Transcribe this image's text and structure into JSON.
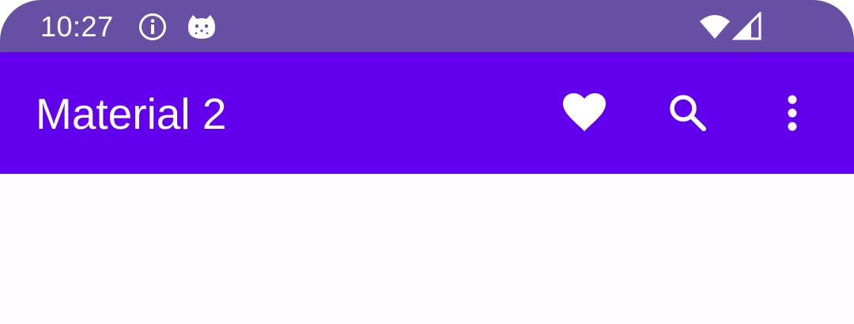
{
  "status_bar": {
    "time": "10:27",
    "icons": [
      "info-icon",
      "cat-icon",
      "wifi-icon",
      "cell-signal-icon"
    ],
    "background_color": "#6750a4"
  },
  "app_bar": {
    "title": "Material 2",
    "background_color": "#6200ee",
    "actions": [
      "heart-icon",
      "search-icon",
      "more-vert-icon"
    ]
  },
  "content": {
    "background_color": "#fffbfe"
  }
}
